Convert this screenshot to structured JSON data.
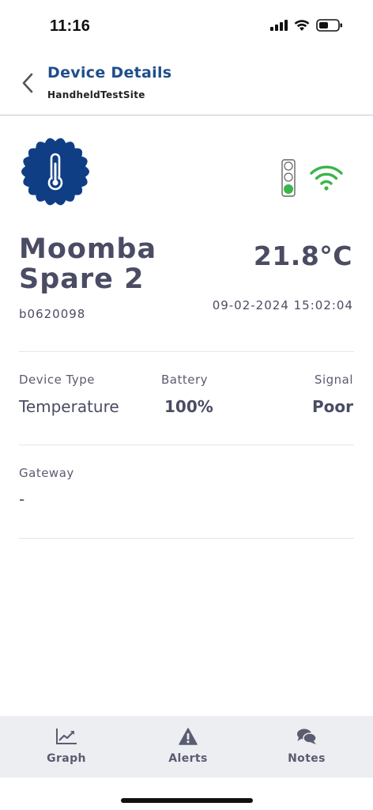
{
  "status_bar": {
    "time": "11:16"
  },
  "header": {
    "title": "Device Details",
    "subtitle": "HandheldTestSite"
  },
  "device": {
    "name": "Moomba Spare 2",
    "id": "b0620098",
    "temperature": "21.8°C",
    "timestamp": "09-02-2024 15:02:04",
    "status_light": "green",
    "icon": "thermometer-icon"
  },
  "details": {
    "device_type_label": "Device Type",
    "device_type_value": "Temperature",
    "battery_label": "Battery",
    "battery_value": "100%",
    "signal_label": "Signal",
    "signal_value": "Poor",
    "gateway_label": "Gateway",
    "gateway_value": "-"
  },
  "tabs": [
    {
      "label": "Graph",
      "icon": "graph-icon"
    },
    {
      "label": "Alerts",
      "icon": "alert-icon"
    },
    {
      "label": "Notes",
      "icon": "notes-icon"
    }
  ],
  "colors": {
    "brand": "#1f4e8a",
    "badge": "#0f3e85",
    "ok": "#3bb54a",
    "text": "#4a4c63",
    "tabbar": "#eceef2"
  }
}
